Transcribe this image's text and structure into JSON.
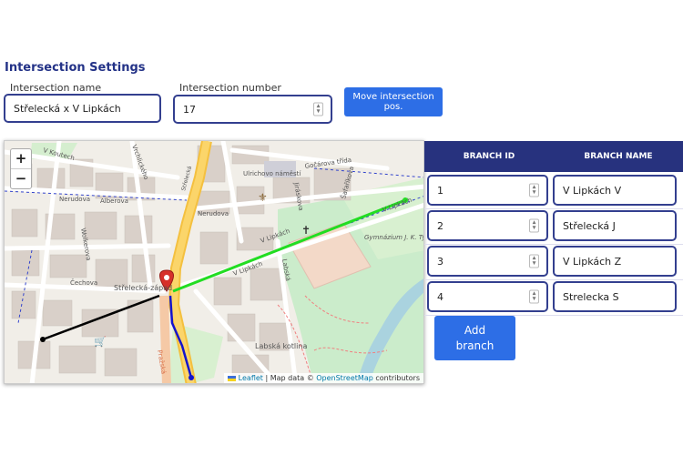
{
  "section_title": "Intersection Settings",
  "intersection_name": {
    "label": "Intersection name",
    "value": "Střelecká x V Lipkách"
  },
  "intersection_number": {
    "label": "Intersection number",
    "value": "17"
  },
  "move_button_label": "Move intersection pos.",
  "map": {
    "zoom_in": "+",
    "zoom_out": "−",
    "attribution": {
      "leaflet": "Leaflet",
      "sep": " | Map data © ",
      "osm": "OpenStreetMap",
      "tail": " contributors"
    },
    "labels": {
      "koutech": "V Koutech",
      "strelecka_top": "Střelecká",
      "vrchlickeho": "Vrchlického",
      "nerudova_left": "Nerudova",
      "nerudova_mid": "Nerudova",
      "alberova": "Alberova",
      "wolkerova": "Wolkerova",
      "cechova": "Čechova",
      "strelecka_zapad": "Střelecká-západ",
      "ulrichovo": "Ulrichovo náměstí",
      "gocarova": "Gočárova třída",
      "jiraskova": "Jiráskova",
      "safarikova": "Šafaříkova",
      "v_lipkach_right": "V Lipkách",
      "v_lipkach_mid": "V Lipkách",
      "v_lipkach_low": "V Lipkách",
      "gymnazium": "Gymnázium J. K. Tyla",
      "labska_kotlina": "Labská kotlina",
      "prazska": "Pražská",
      "labska": "Labská"
    }
  },
  "branches": {
    "head_id": "BRANCH ID",
    "head_name": "BRANCH NAME",
    "rows": [
      {
        "id": "1",
        "name": "V Lipkách V"
      },
      {
        "id": "2",
        "name": "Střelecká J"
      },
      {
        "id": "3",
        "name": "V Lipkách Z"
      },
      {
        "id": "4",
        "name": "Strelecka S"
      }
    ]
  },
  "add_branch_label": "Add branch",
  "colors": {
    "accent": "#2d6ee6",
    "header": "#27327e",
    "title": "#233287",
    "branch_green": "#22dd22",
    "branch_blue": "#1414cc"
  }
}
